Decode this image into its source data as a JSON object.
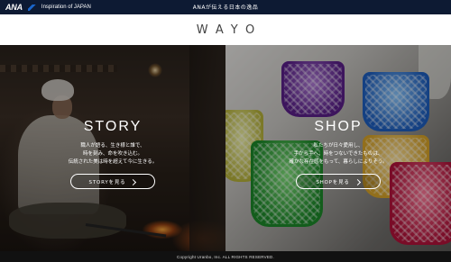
{
  "topbar": {
    "logo_text": "ANA",
    "logo_sub": "Inspiration of JAPAN",
    "title": "ANAが伝える日本の逸品"
  },
  "header": {
    "brand": "WAYO"
  },
  "story": {
    "title": "STORY",
    "lines": [
      "職人が語る、生き様と誰で、",
      "時を刻み、命を吹き込む。",
      "伝統された美は時を超えて今に生きる。"
    ],
    "button_label": "STORYを見る"
  },
  "shop": {
    "title": "SHOP",
    "lines": [
      "私たちが日々愛用し、",
      "手から手へ、時をつないできたものは、",
      "確かな存在感をもって、暮らしによりそう。"
    ],
    "button_label": "SHOPを見る"
  },
  "footer": {
    "copyright": "Copyright Uranbo, Inc. ALL RIGHTS RESERVED."
  }
}
